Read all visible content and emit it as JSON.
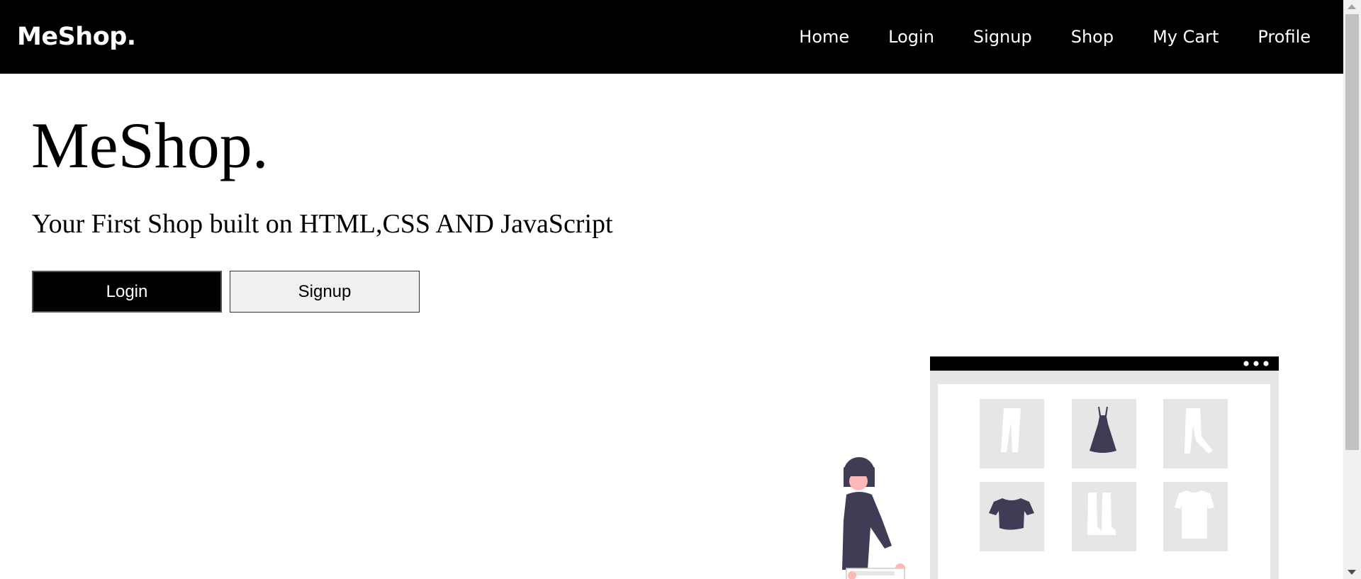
{
  "nav": {
    "brand": "MeShop.",
    "links": [
      "Home",
      "Login",
      "Signup",
      "Shop",
      "My Cart",
      "Profile"
    ]
  },
  "hero": {
    "title": "MeShop.",
    "subtitle": "Your First Shop built on HTML,CSS AND JavaScript",
    "login_label": "Login",
    "signup_label": "Signup"
  },
  "colors": {
    "navbar_bg": "#000000",
    "primary_button_bg": "#000000",
    "secondary_button_bg": "#f0f0f0",
    "illustration_dark": "#3f3d56",
    "illustration_light": "#e6e6e6",
    "illustration_accent": "#ffb8b8"
  }
}
